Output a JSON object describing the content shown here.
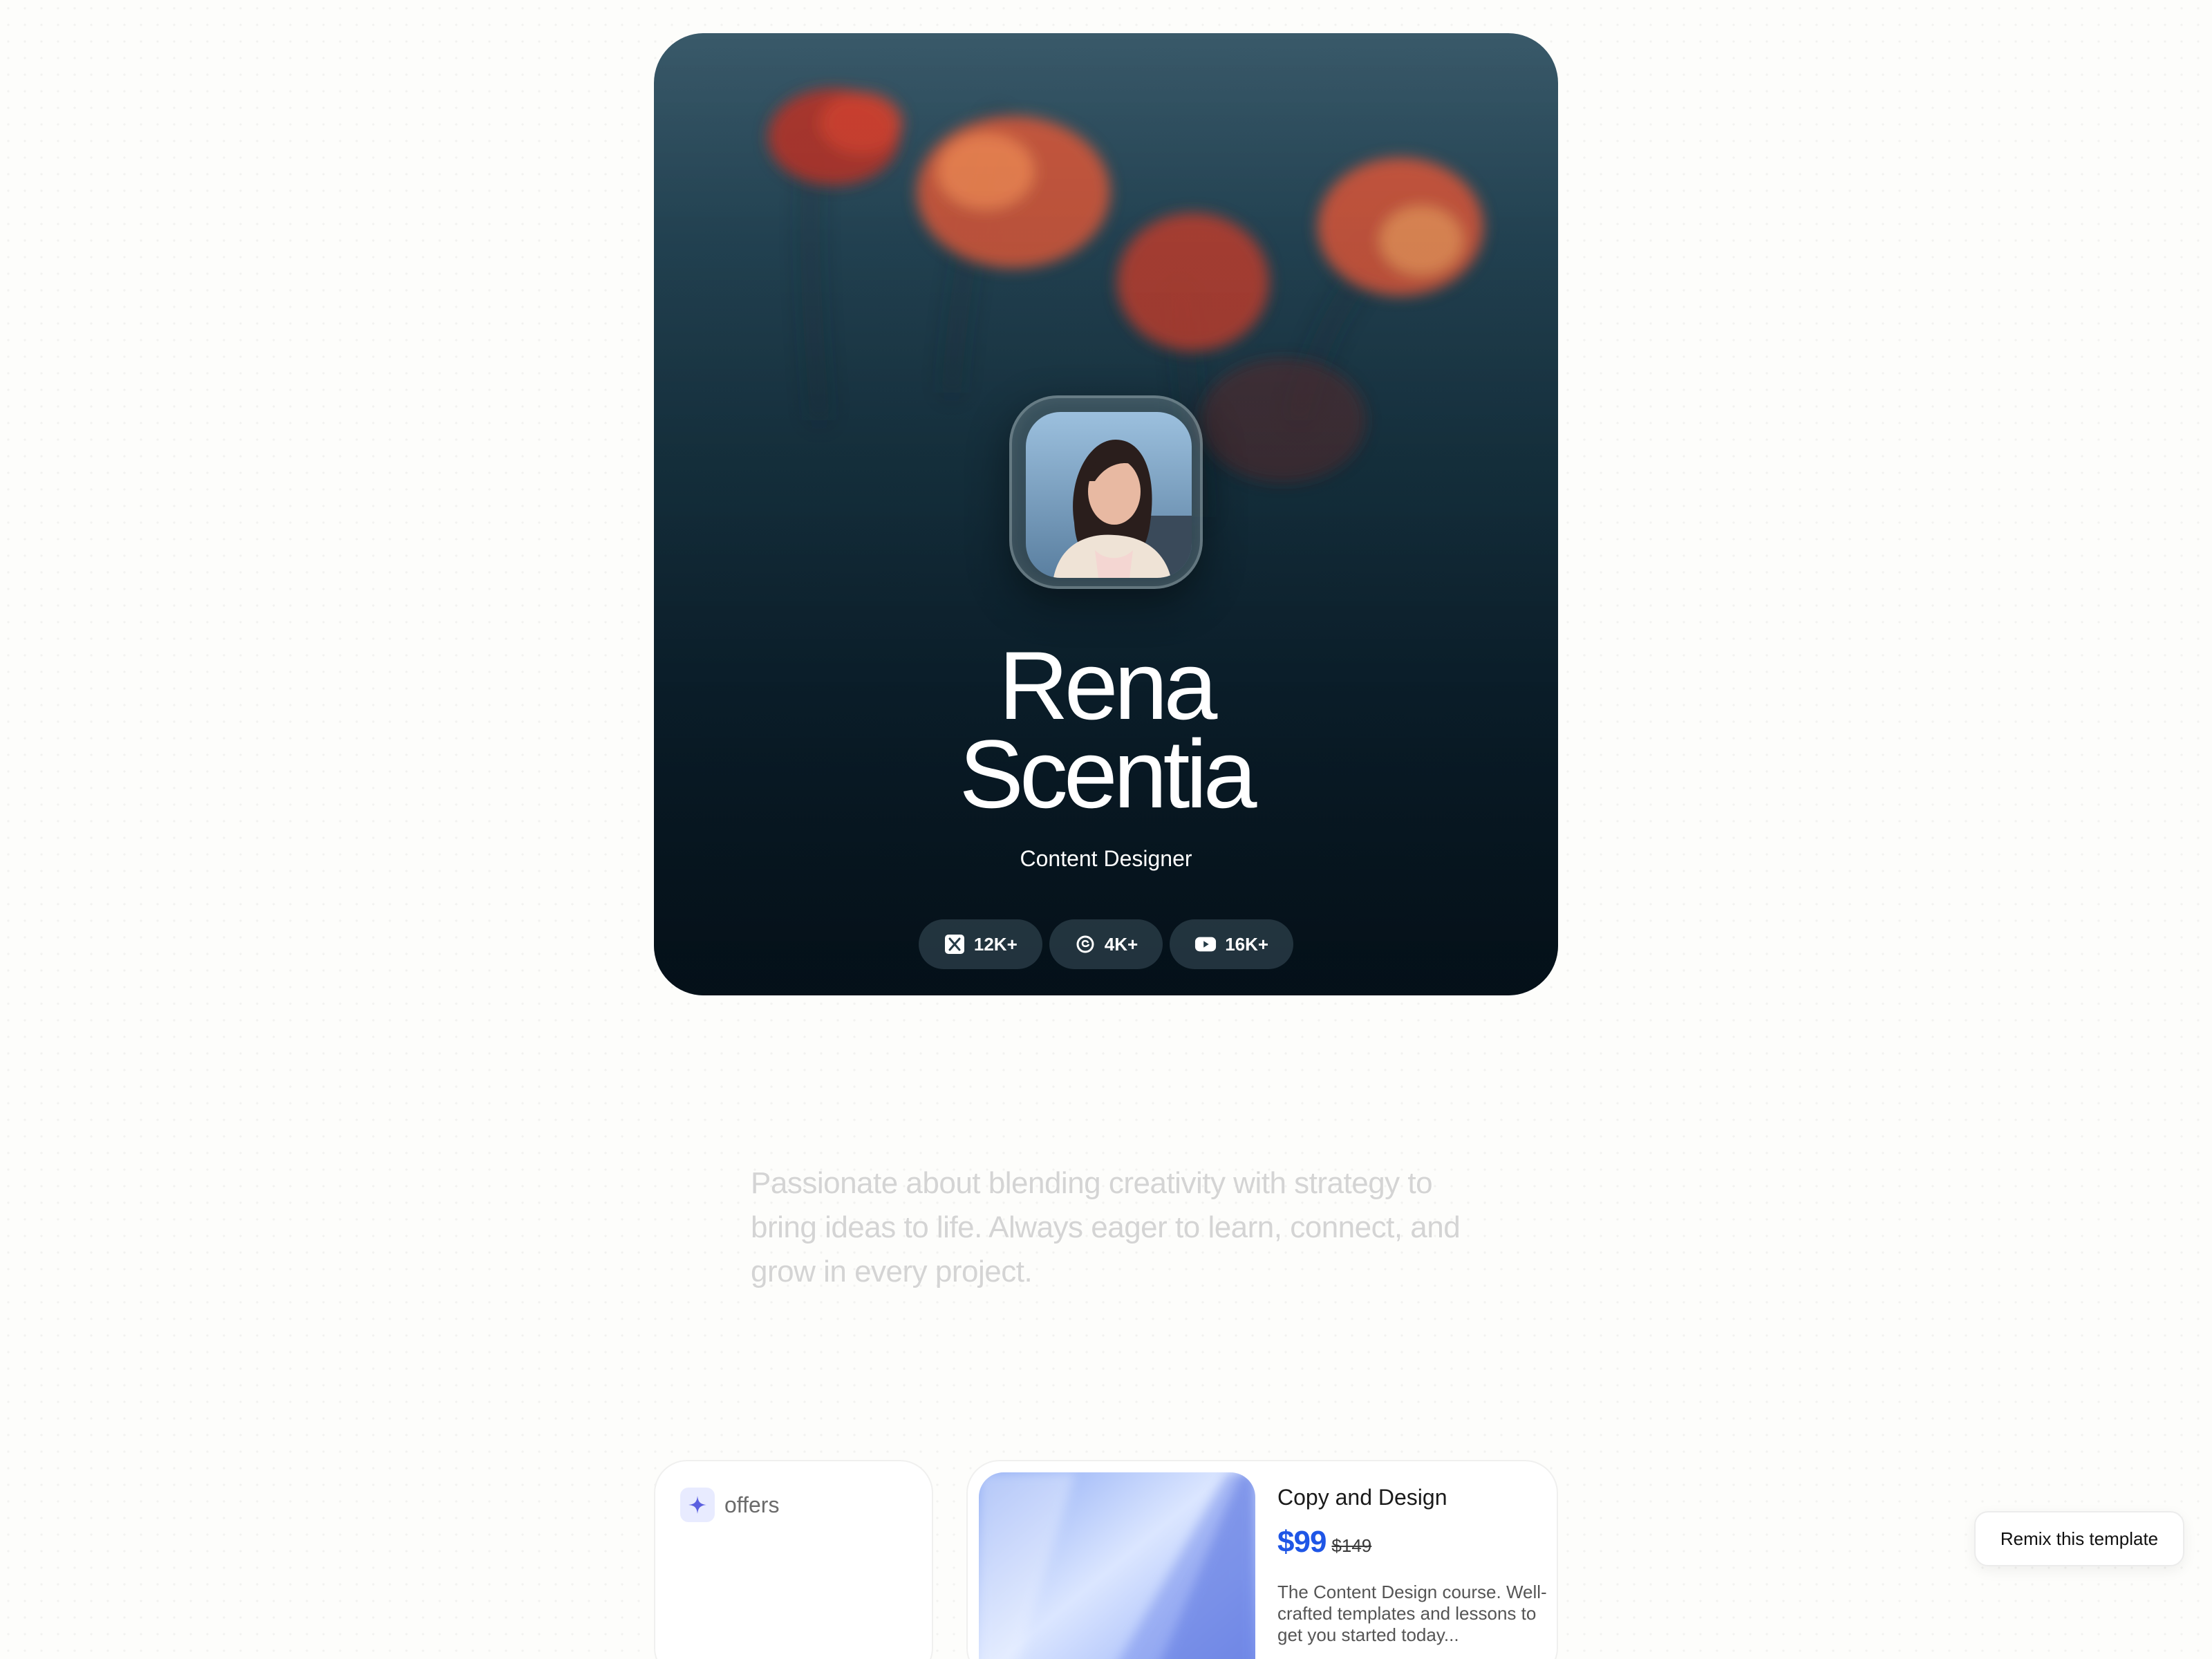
{
  "profile": {
    "first_name": "Rena",
    "last_name": "Scentia",
    "role": "Content Designer"
  },
  "socials": [
    {
      "icon": "x-icon",
      "count": "12K+"
    },
    {
      "icon": "threads-icon",
      "count": "4K+"
    },
    {
      "icon": "youtube-icon",
      "count": "16K+"
    }
  ],
  "bio": {
    "text": "Passionate about blending creativity with strategy to bring ideas to life. Always eager to learn, connect, and grow in every project."
  },
  "offers": {
    "label": "offers",
    "icon": "sparkle-icon"
  },
  "product": {
    "title": "Copy and Design",
    "price": "$99",
    "original_price": "$149",
    "description": "The Content Design course. Well-crafted templates and lessons to get you started today..."
  },
  "remix": {
    "label": "Remix this template"
  },
  "colors": {
    "accent_price": "#1f56e6",
    "hero_dark": "#07141d",
    "background": "#fdfdfb"
  }
}
